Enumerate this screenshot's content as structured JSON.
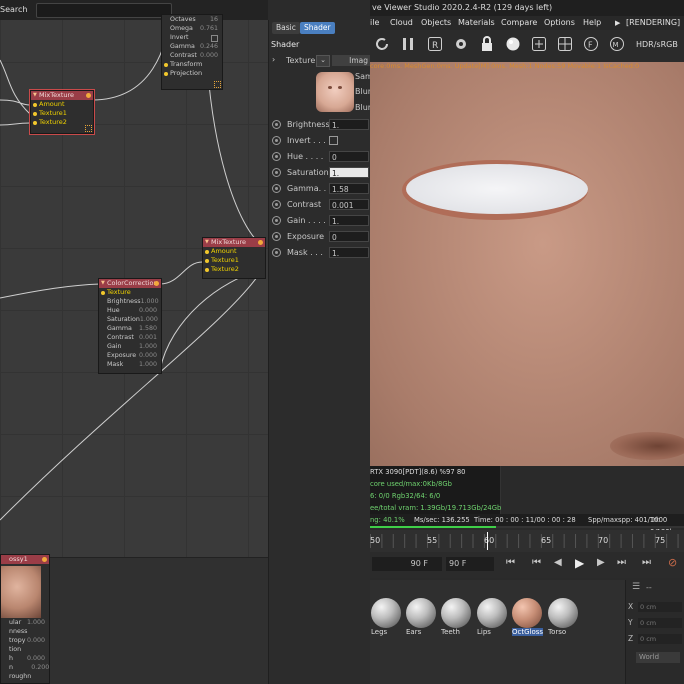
{
  "node_editor": {
    "search_label": "Search",
    "top_node": {
      "params": [
        {
          "name": "Octaves",
          "value": "16"
        },
        {
          "name": "Omega",
          "value": "0.761"
        },
        {
          "name": "Invert",
          "value": ""
        },
        {
          "name": "Gamma",
          "value": "0.246"
        },
        {
          "name": "Contrast",
          "value": "0.000"
        }
      ],
      "ports": [
        "Transform",
        "Projection"
      ]
    },
    "mix1": {
      "title": "MixTexture",
      "ports": [
        "Amount",
        "Texture1",
        "Texture2"
      ]
    },
    "mix2": {
      "title": "MixTexture",
      "ports": [
        "Amount",
        "Texture1",
        "Texture2"
      ]
    },
    "colorcorr": {
      "title": "ColorCorrection",
      "ports": [
        "Texture"
      ],
      "params": [
        {
          "name": "Brightness",
          "value": "1.000"
        },
        {
          "name": "Hue",
          "value": "0.000"
        },
        {
          "name": "Saturation",
          "value": "1.000"
        },
        {
          "name": "Gamma",
          "value": "1.580"
        },
        {
          "name": "Contrast",
          "value": "0.001"
        },
        {
          "name": "Gain",
          "value": "1.000"
        },
        {
          "name": "Exposure",
          "value": "0.000"
        },
        {
          "name": "Mask",
          "value": "1.000"
        }
      ]
    },
    "gloss": {
      "title": "ossy1",
      "params": [
        {
          "name": "ular",
          "value": "1.000"
        },
        {
          "name": "nness",
          "value": ""
        },
        {
          "name": "tropy",
          "value": "0.000"
        },
        {
          "name": "tion",
          "value": ""
        },
        {
          "name": "h",
          "value": "0.000"
        },
        {
          "name": "n roughn",
          "value": "0.200"
        }
      ]
    }
  },
  "attr_panel": {
    "tabs": [
      "Basic",
      "Shader"
    ],
    "section": "Shader",
    "texture_label": "Texture",
    "texture_mode": "Imag",
    "preview_labels": [
      "Sam",
      "Blur",
      "Blur"
    ],
    "params": [
      {
        "label": "Brightness",
        "value": "1."
      },
      {
        "label": "Invert . . .",
        "value": ""
      },
      {
        "label": "Hue . . . .",
        "value": "0"
      },
      {
        "label": "Saturation",
        "value": "1."
      },
      {
        "label": "Gamma. . .",
        "value": "1.58"
      },
      {
        "label": "Contrast",
        "value": "0.001"
      },
      {
        "label": "Gain . . . .",
        "value": "1."
      },
      {
        "label": "Exposure",
        "value": "0"
      },
      {
        "label": "Mask . . .",
        "value": "1."
      }
    ]
  },
  "viewer": {
    "title": "ve Viewer Studio 2020.2.4-R2 (129 days left)",
    "menu": [
      "ile",
      "Cloud",
      "Objects",
      "Materials",
      "Compare",
      "Options",
      "Help"
    ],
    "rendering_label": "[RENDERING]",
    "colorspace": "HDR/sRGB",
    "overlay": "core:0ms. MeshGen:0ms. Update[M]:0ms. Mesh:1 Nodes:59 Movable:1 IsCached:0",
    "status": [
      "RTX 3090[PDT](8.6)   %97   80",
      "core used/max:0Kb/8Gb",
      "6: 0/0          Rgb32/64: 6/0",
      "ee/total vram: 1.39Gb/19.713Gb/24Gb"
    ],
    "progress": {
      "percent_label": "ng: 40.1%",
      "ms_sec": "Ms/sec: 136.255",
      "time": "Time: 00 : 00 : 11/00 : 00 : 28",
      "spp": "Spp/maxspp: 401/1000",
      "tri": "Tri: 0/130k",
      "fraction": 0.401
    },
    "timeline": {
      "ticks": [
        "50",
        "55",
        "60",
        "65",
        "70",
        "75"
      ],
      "current": "60"
    },
    "frame_fields": [
      "90 F",
      "90 F"
    ],
    "materials": [
      "Legs",
      "Ears",
      "Teeth",
      "Lips",
      "OctGloss",
      "Torso"
    ],
    "selected_material": "OctGloss",
    "coords": [
      {
        "axis": "X",
        "value": "0 cm"
      },
      {
        "axis": "Y",
        "value": "0 cm"
      },
      {
        "axis": "Z",
        "value": "0 cm"
      }
    ],
    "coord_mode": "World",
    "coord_header": "--"
  }
}
